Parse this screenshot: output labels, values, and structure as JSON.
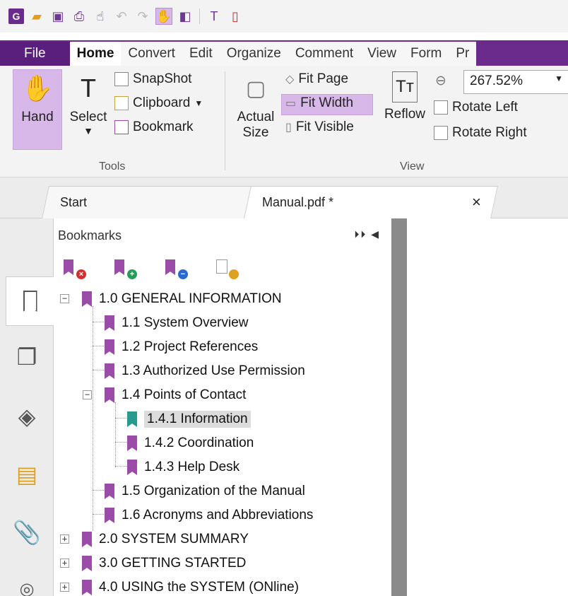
{
  "colors": {
    "brand": "#6a2b8c",
    "highlight": "#d8b8e8",
    "bookmark": "#9a4ca8",
    "bookmark_active": "#2a9a8e",
    "splitter": "#8a8a8a"
  },
  "qat_icons": [
    "app-logo-icon",
    "open-folder-icon",
    "save-icon",
    "print-icon",
    "hand-dropdown-icon",
    "undo-icon",
    "redo-icon",
    "hand-tool-icon",
    "compare-icon",
    "select-text-icon",
    "new-doc-icon"
  ],
  "ribbon_tabs": [
    "File",
    "Home",
    "Convert",
    "Edit",
    "Organize",
    "Comment",
    "View",
    "Form",
    "Pr"
  ],
  "tools": {
    "hand": "Hand",
    "select": "Select",
    "snapshot": "SnapShot",
    "clipboard": "Clipboard",
    "bookmark": "Bookmark",
    "group": "Tools"
  },
  "view": {
    "actual_size_1": "Actual",
    "actual_size_2": "Size",
    "fit_page": "Fit Page",
    "fit_width": "Fit Width",
    "fit_visible": "Fit Visible",
    "reflow": "Reflow",
    "zoom": "267.52%",
    "rotate_left": "Rotate Left",
    "rotate_right": "Rotate Right",
    "group": "View"
  },
  "doc_tabs": {
    "start": "Start",
    "manual": "Manual.pdf *",
    "close": "×"
  },
  "panel": {
    "title": "Bookmarks",
    "controls": "⏵⏵ ◀"
  },
  "bookmarks": [
    {
      "label": "1.0 GENERAL INFORMATION",
      "level": 0,
      "expander": "−"
    },
    {
      "label": "1.1 System Overview",
      "level": 1
    },
    {
      "label": "1.2 Project References",
      "level": 1
    },
    {
      "label": "1.3 Authorized Use Permission",
      "level": 1
    },
    {
      "label": "1.4 Points of Contact",
      "level": 1,
      "expander": "−"
    },
    {
      "label": "1.4.1 Information",
      "level": 2,
      "selected": true
    },
    {
      "label": "1.4.2 Coordination",
      "level": 2
    },
    {
      "label": "1.4.3 Help Desk",
      "level": 2
    },
    {
      "label": "1.5 Organization of the Manual",
      "level": 1
    },
    {
      "label": "1.6 Acronyms and Abbreviations",
      "level": 1
    },
    {
      "label": "2.0 SYSTEM SUMMARY",
      "level": 0,
      "expander": "+"
    },
    {
      "label": "3.0 GETTING STARTED",
      "level": 0,
      "expander": "+"
    },
    {
      "label": "4.0 USING the SYSTEM (ONline)",
      "level": 0,
      "expander": "+"
    }
  ]
}
